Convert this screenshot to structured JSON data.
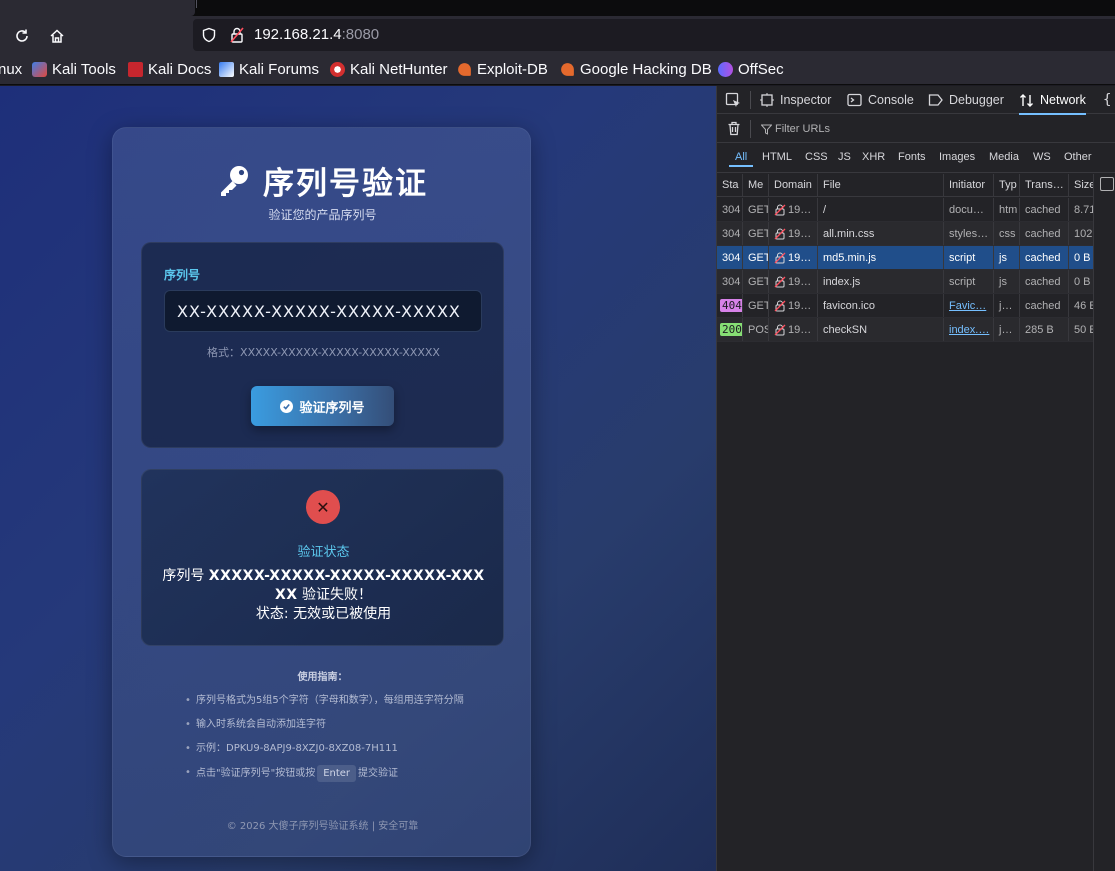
{
  "browser": {
    "url_host": "192.168.21.4",
    "url_port": ":8080",
    "bookmarks": [
      {
        "label": "nux",
        "icon": "none"
      },
      {
        "label": "Kali Tools",
        "icon": "kali-tools-icon"
      },
      {
        "label": "Kali Docs",
        "icon": "kali-docs-icon"
      },
      {
        "label": "Kali Forums",
        "icon": "kali-forums-icon"
      },
      {
        "label": "Kali NetHunter",
        "icon": "kali-nethunter-icon"
      },
      {
        "label": "Exploit-DB",
        "icon": "exploit-db-icon"
      },
      {
        "label": "Google Hacking DB",
        "icon": "ghdb-icon"
      },
      {
        "label": "OffSec",
        "icon": "offsec-icon"
      }
    ]
  },
  "page": {
    "title": "序列号验证",
    "subtitle": "验证您的产品序列号",
    "form": {
      "label": "序列号",
      "input_value": "XX-XXXXX-XXXXX-XXXXX-XXXXX",
      "hint": "格式：XXXXX-XXXXX-XXXXX-XXXXX-XXXXX",
      "button_label": "验证序列号"
    },
    "status": {
      "title": "验证状态",
      "prefix": "序列号 ",
      "serial": "XXXXX-XXXXX-XXXXX-XXXXX-XXXXX",
      "suffix": " 验证失败！",
      "state_line": "状态: 无效或已被使用"
    },
    "guide": {
      "title": "使用指南：",
      "items": [
        "序列号格式为5组5个字符（字母和数字），每组用连字符分隔",
        "输入时系统会自动添加连字符",
        "示例：DPKU9-8APJ9-8XZJ0-8XZ08-7H111"
      ],
      "last_item_before": "点击\"验证序列号\"按钮或按",
      "last_item_key": "Enter",
      "last_item_after": "提交验证"
    },
    "footer": "© 2026 大傻子序列号验证系统 | 安全可靠"
  },
  "devtools": {
    "tabs": [
      "Inspector",
      "Console",
      "Debugger",
      "Network"
    ],
    "active_tab": "Network",
    "filter_placeholder": "Filter URLs",
    "types": [
      "All",
      "HTML",
      "CSS",
      "JS",
      "XHR",
      "Fonts",
      "Images",
      "Media",
      "WS",
      "Other"
    ],
    "columns": [
      "Sta",
      "Me",
      "Domain",
      "File",
      "Initiator",
      "Typ",
      "Trans…",
      "Size"
    ],
    "requests": [
      {
        "status": "304",
        "method": "GET",
        "domain": "19…",
        "file": "/",
        "initiator": "docu…",
        "type": "htm",
        "transferred": "cached",
        "size": "8.71",
        "selected": false
      },
      {
        "status": "304",
        "method": "GET",
        "domain": "19…",
        "file": "all.min.css",
        "initiator": "styles…",
        "type": "css",
        "transferred": "cached",
        "size": "102",
        "selected": false
      },
      {
        "status": "304",
        "method": "GET",
        "domain": "19…",
        "file": "md5.min.js",
        "initiator": "script",
        "type": "js",
        "transferred": "cached",
        "size": "0 B",
        "selected": true
      },
      {
        "status": "304",
        "method": "GET",
        "domain": "19…",
        "file": "index.js",
        "initiator": "script",
        "type": "js",
        "transferred": "cached",
        "size": "0 B",
        "selected": false
      },
      {
        "status": "404",
        "method": "GET",
        "domain": "19…",
        "file": "favicon.ico",
        "initiator": "Favic…",
        "type": "j…",
        "transferred": "cached",
        "size": "46 E",
        "selected": false
      },
      {
        "status": "200",
        "method": "POS",
        "domain": "19…",
        "file": "checkSN",
        "initiator": "index.…",
        "type": "j…",
        "transferred": "285 B",
        "size": "50 E",
        "selected": false
      }
    ]
  },
  "colors": {
    "accent_cyan": "#5cc8ee",
    "fail_red": "#e04e4e",
    "devtools_blue": "#75bfff",
    "status_404": "#d782e8",
    "status_200": "#86de74"
  }
}
